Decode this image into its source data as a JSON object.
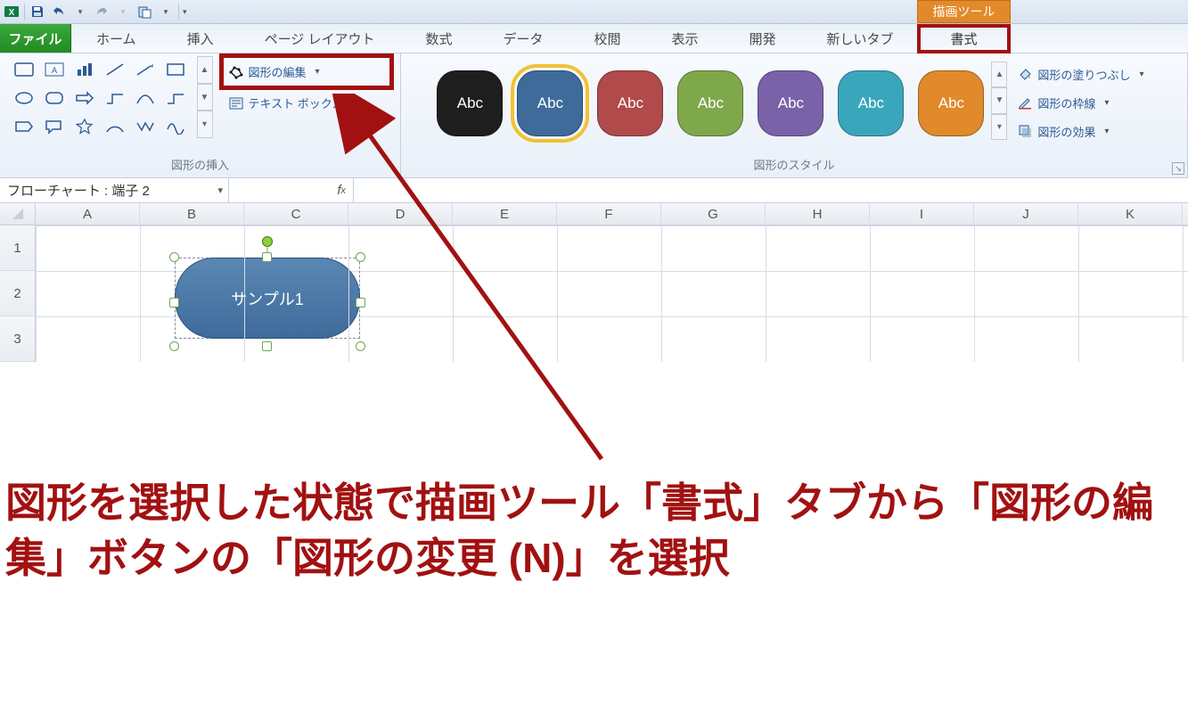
{
  "qat": {
    "tooltip_excel": "Excel",
    "tooltip_save": "Save",
    "tooltip_undo": "Undo",
    "tooltip_redo": "Redo"
  },
  "drawing_tools_label": "描画ツール",
  "tabs": {
    "file": "ファイル",
    "home": "ホーム",
    "insert": "挿入",
    "pagelayout": "ページ レイアウト",
    "formulas": "数式",
    "data": "データ",
    "review": "校閲",
    "view": "表示",
    "developer": "開発",
    "newtab": "新しいタブ",
    "format": "書式"
  },
  "ribbon": {
    "insert_shapes_group": "図形の挿入",
    "shape_styles_group": "図形のスタイル",
    "edit_shape": "図形の編集",
    "text_box": "テキスト ボックス",
    "swatch_label": "Abc",
    "fill": "図形の塗りつぶし",
    "outline": "図形の枠線",
    "effects": "図形の効果"
  },
  "namebox": "フローチャート : 端子 2",
  "fx": "fx",
  "columns": [
    "A",
    "B",
    "C",
    "D",
    "E",
    "F",
    "G",
    "H",
    "I",
    "J",
    "K"
  ],
  "rows": [
    "1",
    "2",
    "3"
  ],
  "shape_text": "サンプル1",
  "annotation": "図形を選択した状態で描画ツール「書式」タブから「図形の編集」ボタンの「図形の変更 (N)」を選択",
  "style_swatches": [
    {
      "bg": "#1e1e1e"
    },
    {
      "bg": "#3e6b9a",
      "selected": true
    },
    {
      "bg": "#b14a4a"
    },
    {
      "bg": "#7fa84b"
    },
    {
      "bg": "#7a62a8"
    },
    {
      "bg": "#3aa6bc"
    },
    {
      "bg": "#e08a2b"
    }
  ]
}
